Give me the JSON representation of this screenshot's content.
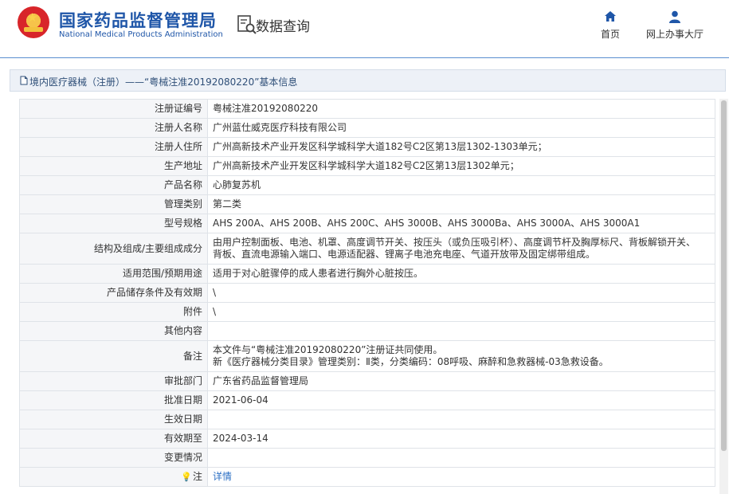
{
  "header": {
    "title_cn": "国家药品监督管理局",
    "title_en": "National Medical Products Administration",
    "query_label": "数据查询",
    "nav": [
      {
        "label": "首页",
        "icon": "home-icon"
      },
      {
        "label": "网上办事大厅",
        "icon": "user-icon"
      }
    ]
  },
  "breadcrumb": {
    "text": "境内医疗器械（注册）——“粤械注准20192080220”基本信息"
  },
  "rows": [
    {
      "label": "注册证编号",
      "value": "粤械注准20192080220"
    },
    {
      "label": "注册人名称",
      "value": "广州蓝仕威克医疗科技有限公司"
    },
    {
      "label": "注册人住所",
      "value": "广州高新技术产业开发区科学城科学大道182号C2区第13层1302-1303单元；"
    },
    {
      "label": "生产地址",
      "value": "广州高新技术产业开发区科学城科学大道182号C2区第13层1302单元；"
    },
    {
      "label": "产品名称",
      "value": "心肺复苏机"
    },
    {
      "label": "管理类别",
      "value": "第二类"
    },
    {
      "label": "型号规格",
      "value": "AHS 200A、AHS 200B、AHS 200C、AHS 3000B、AHS 3000Ba、AHS 3000A、AHS 3000A1"
    },
    {
      "label": "结构及组成/主要组成成分",
      "value": "由用户控制面板、电池、机罩、高度调节开关、按压头（或负压吸引杯）、高度调节杆及胸厚标尺、背板解锁开关、",
      "value2": "背板、直流电源输入端口、电源适配器、锂离子电池充电座、气道开放带及固定绑带组成。"
    },
    {
      "label": "适用范围/预期用途",
      "value": "适用于对心脏骤停的成人患者进行胸外心脏按压。"
    },
    {
      "label": "产品储存条件及有效期",
      "value": "\\"
    },
    {
      "label": "附件",
      "value": "\\"
    },
    {
      "label": "其他内容",
      "value": ""
    },
    {
      "label": "备注",
      "value": "本文件与“粤械注准20192080220”注册证共同使用。",
      "value2": "新《医疗器械分类目录》管理类别：Ⅱ类，分类编码：08呼吸、麻醉和急救器械-03急救设备。"
    },
    {
      "label": "审批部门",
      "value": "广东省药品监督管理局"
    },
    {
      "label": "批准日期",
      "value": "2021-06-04"
    },
    {
      "label": "生效日期",
      "value": ""
    },
    {
      "label": "有效期至",
      "value": "2024-03-14"
    },
    {
      "label": "变更情况",
      "value": ""
    },
    {
      "label": "注",
      "value": "详情"
    }
  ],
  "colors": {
    "brand": "#1f56a8",
    "link": "#2b6fc4",
    "label_bg": "#f5f6f8"
  }
}
